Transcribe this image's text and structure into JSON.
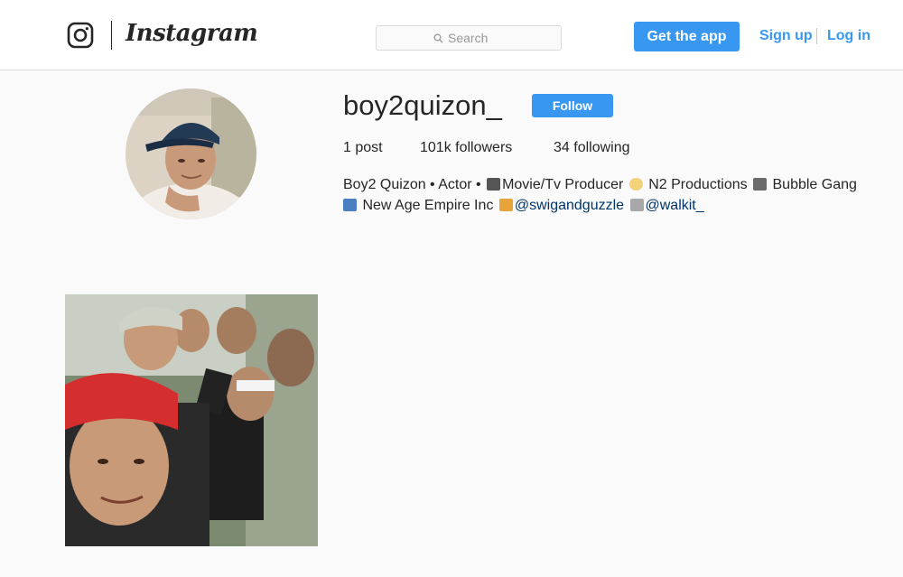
{
  "header": {
    "logo_icon": "instagram-camera-icon",
    "wordmark": "Instagram",
    "search": {
      "placeholder": "Search",
      "icon": "search-icon"
    },
    "get_app_label": "Get the app",
    "signup_label": "Sign up",
    "login_label": "Log in"
  },
  "profile": {
    "username": "boy2quizon_",
    "follow_label": "Follow",
    "stats": {
      "posts": "1 post",
      "followers": "101k followers",
      "following": "34 following"
    },
    "bio": {
      "line1": {
        "a": "Boy2 Quizon • Actor • ",
        "icon1": "movie-camera-emoji",
        "b": "Movie/Tv Producer ",
        "icon2": "dizzy-emoji",
        "c": " N2 Productions ",
        "icon3": "clapper-board-emoji",
        "d": " Bubble Gang"
      },
      "line2": {
        "icon1": "computer-emoji",
        "a": " New Age Empire Inc ",
        "icon2": "beer-mugs-emoji",
        "mention1": "@swigandguzzle",
        "icon3": "sandal-emoji",
        "mention2": "@walkit_"
      }
    }
  },
  "posts": [
    {
      "type": "photo",
      "description_icon": "group-selfie-photo"
    }
  ],
  "colors": {
    "accent": "#3897f0",
    "mention": "#003569",
    "background": "#fafafa",
    "border": "#dbdbdb"
  }
}
